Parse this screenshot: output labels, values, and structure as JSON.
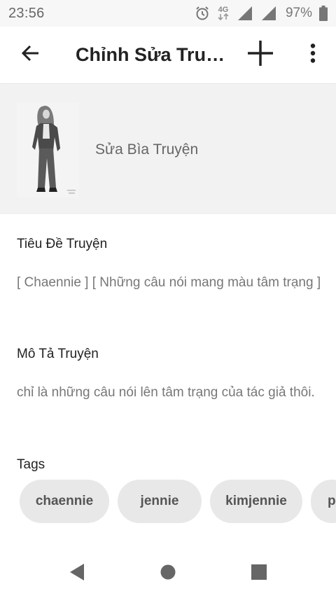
{
  "status_bar": {
    "time": "23:56",
    "network": "4G",
    "battery": "97%",
    "icons": [
      "alarm-icon",
      "network-4g-icon",
      "signal-icon",
      "signal-icon",
      "battery-icon"
    ]
  },
  "app_bar": {
    "title": "Chỉnh Sửa Truyện",
    "back_icon": "arrow-left-icon",
    "add_icon": "plus-icon",
    "more_icon": "more-vertical-icon"
  },
  "cover": {
    "edit_label": "Sửa Bìa Truyện"
  },
  "title_field": {
    "label": "Tiêu Đề Truyện",
    "value": "[ Chaennie ] [ Những câu nói mang màu tâm trạng ]"
  },
  "description_field": {
    "label": "Mô Tả Truyện",
    "value": "chỉ là những câu nói lên tâm trạng của tác giả thôi."
  },
  "tags": {
    "label": "Tags",
    "items": [
      "chaennie",
      "jennie",
      "kimjennie",
      "p"
    ]
  },
  "colors": {
    "background": "#ffffff",
    "cover_section_bg": "#f2f2f2",
    "chip_bg": "#e8e8e8",
    "text_primary": "#222222",
    "text_secondary": "#777777"
  }
}
